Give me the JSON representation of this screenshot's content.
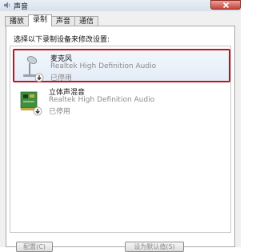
{
  "window": {
    "title": "声音"
  },
  "tabs": [
    {
      "label": "播放"
    },
    {
      "label": "录制"
    },
    {
      "label": "声音"
    },
    {
      "label": "通信"
    }
  ],
  "instruction": "选择以下录制设备来修改设置:",
  "devices": [
    {
      "name": "麦克风",
      "driver": "Realtek High Definition Audio",
      "status": "已停用",
      "icon": "microphone-icon",
      "selected": true
    },
    {
      "name": "立体声混音",
      "driver": "Realtek High Definition Audio",
      "status": "已停用",
      "icon": "sound-card-icon",
      "selected": false
    }
  ],
  "buttons": {
    "configure": "配置(C)",
    "set_default": "设为默认值(S)"
  },
  "colors": {
    "selection_border": "#c4121b",
    "close_button": "#c6453a",
    "disabled_text": "#8a8a8a"
  }
}
